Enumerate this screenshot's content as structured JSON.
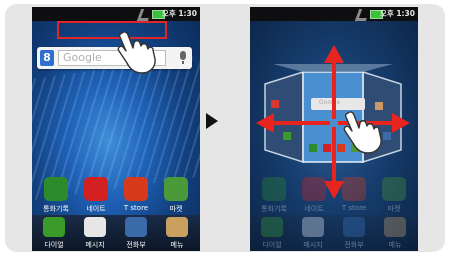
{
  "status_bar": {
    "time": "오후 1:30"
  },
  "search_widget": {
    "logo": "8",
    "placeholder": "Google"
  },
  "apps": [
    {
      "label": "통화기록",
      "color": "#2c8c2c"
    },
    {
      "label": "네이트",
      "color": "#d32020"
    },
    {
      "label": "T store",
      "color": "#d63a1a"
    },
    {
      "label": "마켓",
      "color": "#4a9a3a"
    }
  ],
  "dock": [
    {
      "label": "다이얼",
      "color": "#3a9a2a"
    },
    {
      "label": "메시지",
      "color": "#e6e6e6"
    },
    {
      "label": "전화부",
      "color": "#3a6aa8"
    },
    {
      "label": "메뉴",
      "color": "#c9a060"
    }
  ],
  "mini_search": {
    "placeholder": "Google"
  }
}
